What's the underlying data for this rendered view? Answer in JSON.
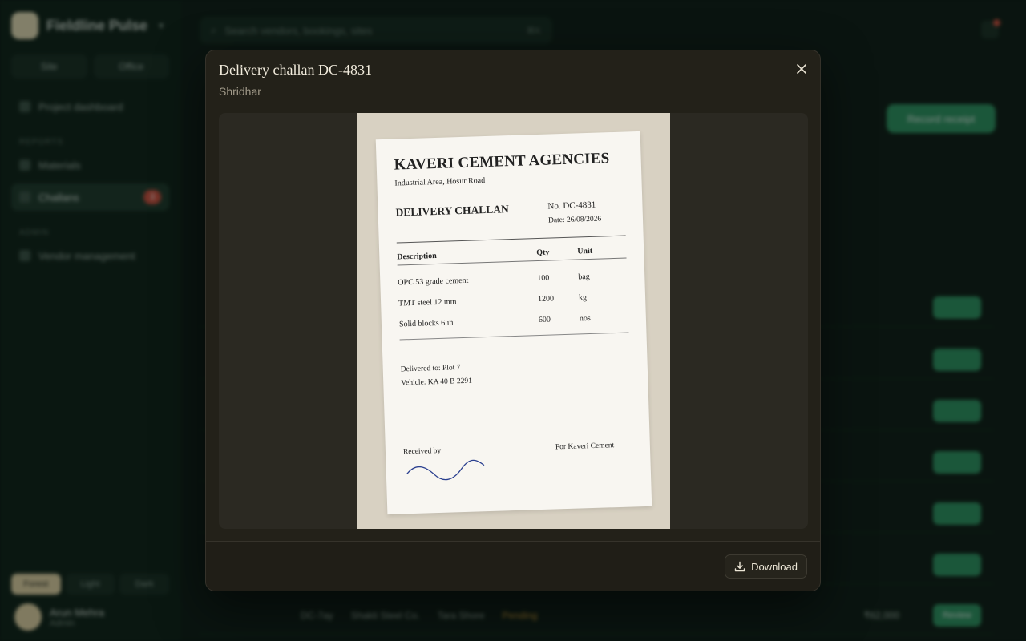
{
  "background": {
    "brand_name": "Fieldline Pulse",
    "mode_buttons": [
      "Site",
      "Office"
    ],
    "nav": {
      "dashboard": "Project dashboard",
      "section_1": "Reports",
      "materials": "Materials",
      "challans": "Challans",
      "challans_count": "3",
      "section_2": "Admin",
      "vendor_mgmt": "Vendor management"
    },
    "theme_buttons": [
      "Forest",
      "Light",
      "Dark"
    ],
    "user": {
      "name": "Arun Mehra",
      "role": "Admin"
    },
    "search_placeholder": "Search vendors, bookings, sites",
    "search_shortcut": "⌘K",
    "primary_button": "Record receipt",
    "last_row": {
      "id": "DC-7ay",
      "vendor": "Shakti Steel Co.",
      "site": "Tara Shore",
      "amount": "₹62,000",
      "status": "Pending",
      "action": "Review"
    }
  },
  "modal": {
    "title": "Delivery challan DC-4831",
    "subtitle": "Shridhar",
    "download_label": "Download",
    "close_icon": "close-icon",
    "download_icon": "download-icon"
  },
  "document": {
    "company": "KAVERI CEMENT AGENCIES",
    "address": "Industrial Area, Hosur Road",
    "doc_title": "DELIVERY CHALLAN",
    "number": "No. DC-4831",
    "date": "Date: 26/08/2026",
    "headers": {
      "description": "Description",
      "qty": "Qty",
      "unit": "Unit"
    },
    "items": [
      {
        "description": "OPC 53 grade cement",
        "qty": "100",
        "unit": "bag"
      },
      {
        "description": "TMT steel 12 mm",
        "qty": "1200",
        "unit": "kg"
      },
      {
        "description": "Solid blocks 6 in",
        "qty": "600",
        "unit": "nos"
      }
    ],
    "delivered_to": "Delivered to: Plot 7",
    "vehicle": "Vehicle: KA 40 B 2291",
    "received_by": "Received by",
    "for_company": "For Kaveri Cement"
  }
}
